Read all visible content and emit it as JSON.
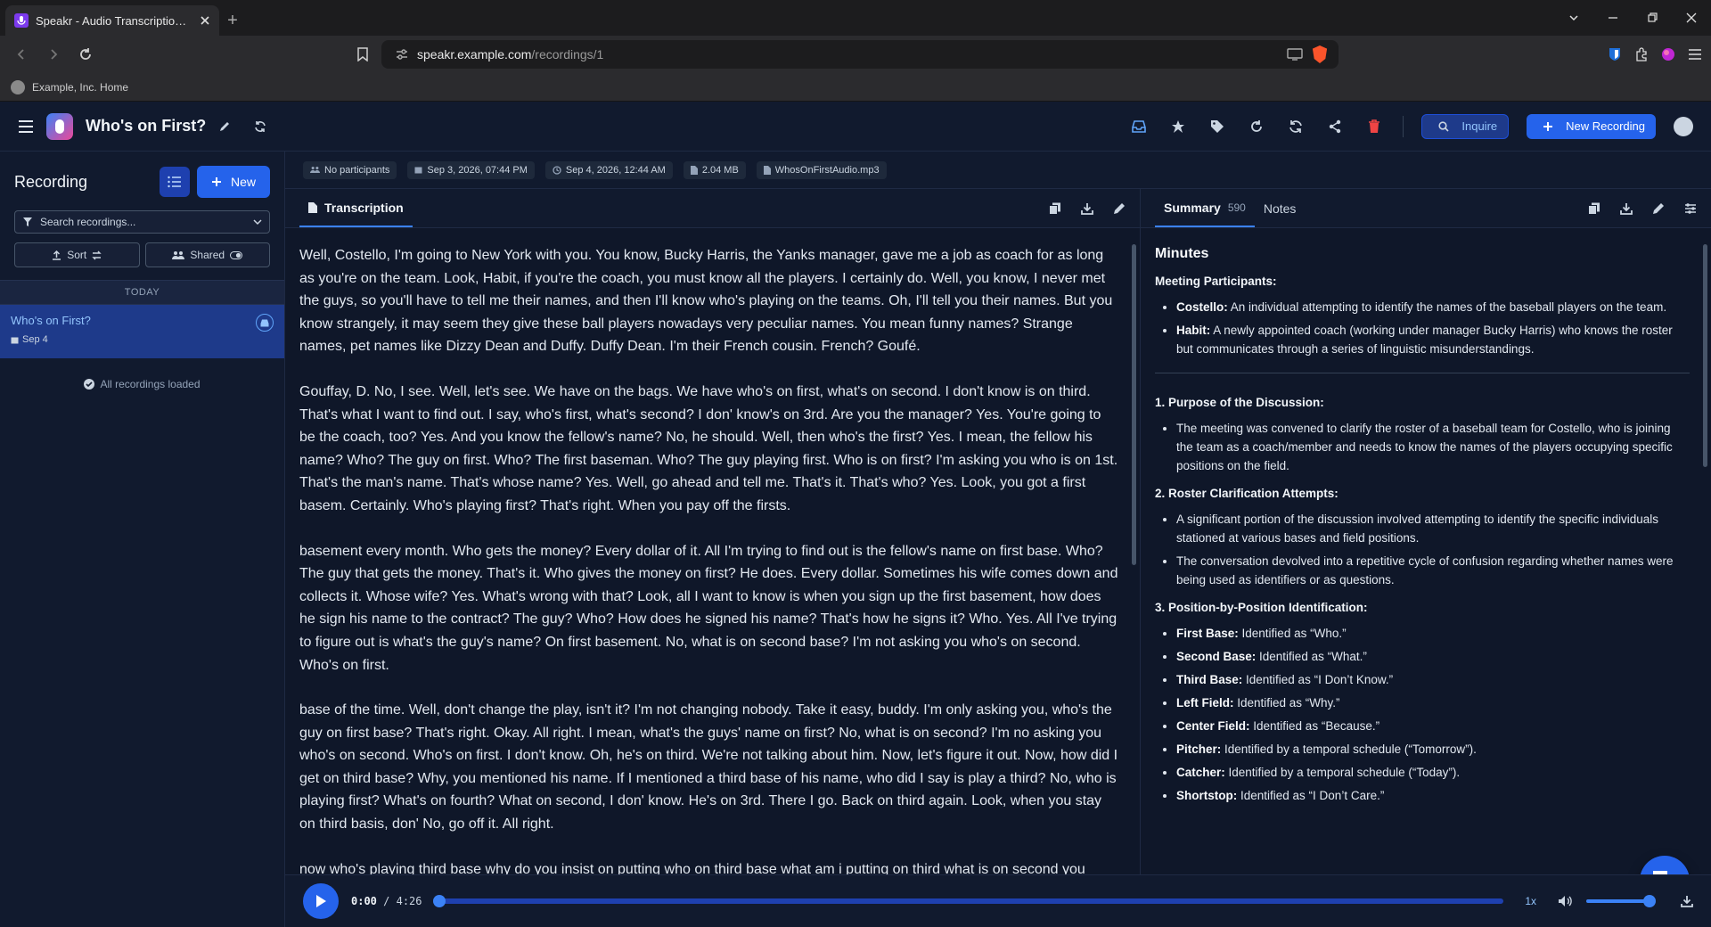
{
  "browser": {
    "tab_title": "Speakr - Audio Transcription & S",
    "url_host": "speakr.example.com",
    "url_path": "/recordings/1",
    "bookmark": "Example, Inc. Home"
  },
  "header": {
    "title": "Who's on First?",
    "inquire_label": "Inquire",
    "new_recording_label": "New Recording"
  },
  "sidebar": {
    "title": "Recording",
    "new_label": "New",
    "search_placeholder": "Search recordings...",
    "sort_label": "Sort",
    "shared_label": "Shared",
    "group_label": "TODAY",
    "items": [
      {
        "title": "Who's on First?",
        "date": "Sep 4"
      }
    ],
    "loaded_label": "All recordings loaded"
  },
  "meta": {
    "participants": "No participants",
    "created": "Sep 3, 2026, 07:44 PM",
    "processed": "Sep 4, 2026, 12:44 AM",
    "size": "2.04 MB",
    "filename": "WhosOnFirstAudio.mp3"
  },
  "left_pane": {
    "tab_label": "Transcription",
    "paragraphs": [
      "Well, Costello, I'm going to New York with you. You know, Bucky Harris, the Yanks manager, gave me a job as coach for as long as you're on the team. Look, Habit, if you're the coach, you must know all the players. I certainly do. Well, you know, I never met the guys, so you'll have to tell me their names, and then I'll know who's playing on the teams. Oh, I'll tell you their names. But you know strangely, it may seem they give these ball players nowadays very peculiar names. You mean funny names? Strange names, pet names like Dizzy Dean and Duffy. Duffy Dean. I'm their French cousin. French? Goufé.",
      "Gouffay, D. No, I see. Well, let's see. We have on the bags. We have who's on first, what's on second. I don't know is on third. That's what I want to find out. I say, who's first, what's second? I don' know's on 3rd. Are you the manager? Yes. You're going to be the coach, too? Yes. And you know the fellow's name? No, he should. Well, then who's the first? Yes. I mean, the fellow his name? Who? The guy on first. Who? The first baseman. Who? The guy playing first. Who is on first? I'm asking you who is on 1st. That's the man's name. That's whose name? Yes. Well, go ahead and tell me. That's it. That's who? Yes. Look, you got a first basem. Certainly. Who's playing first? That's right. When you pay off the firsts.",
      "basement every month. Who gets the money? Every dollar of it. All I'm trying to find out is the fellow's name on first base. Who? The guy that gets the money. That's it. Who gives the money on first? He does. Every dollar. Sometimes his wife comes down and collects it. Whose wife? Yes. What's wrong with that? Look, all I want to know is when you sign up the first basement, how does he sign his name to the contract? The guy? Who? How does he signed his name? That's how he signs it? Who. Yes. All I've trying to figure out is what's the guy's name? On first basement. No, what is on second base? I'm not asking you who's on second. Who's on first.",
      "base of the time. Well, don't change the play, isn't it? I'm not changing nobody. Take it easy, buddy. I'm only asking you, who's the guy on first base? That's right. Okay. All right. I mean, what's the guys' name on first? No, what is on second? I'm no asking you who's on second. Who's on first. I don't know. Oh, he's on third. We're not talking about him. Now, let's figure it out. Now, how did I get on third base? Why, you mentioned his name. If I mentioned a third base of his name, who did I say is play a third? No, who is playing first? What's on fourth? What on second, I don' know. He's on 3rd. There I go. Back on third again. Look, when you stay on third basis, don' No, go off it. All right.",
      "now who's playing third base why do you insist on putting who on third base what am i putting on third what is on second you"
    ]
  },
  "right_pane": {
    "summary_tab": "Summary",
    "summary_count": "590",
    "notes_tab": "Notes",
    "minutes_heading": "Minutes",
    "participants_heading": "Meeting Participants:",
    "participants": [
      {
        "name": "Costello:",
        "desc": " An individual attempting to identify the names of the baseball players on the team."
      },
      {
        "name": "Habit:",
        "desc": " A newly appointed coach (working under manager Bucky Harris) who knows the roster but communicates through a series of linguistic misunderstandings."
      }
    ],
    "purpose_heading": "1. Purpose of the Discussion:",
    "purpose_items": [
      "The meeting was convened to clarify the roster of a baseball team for Costello, who is joining the team as a coach/member and needs to know the names of the players occupying specific positions on the field."
    ],
    "roster_heading": "2. Roster Clarification Attempts:",
    "roster_items": [
      "A significant portion of the discussion involved attempting to identify the specific individuals stationed at various bases and field positions.",
      "The conversation devolved into a repetitive cycle of confusion regarding whether names were being used as identifiers or as questions."
    ],
    "positions_heading": "3. Position-by-Position Identification:",
    "positions": [
      {
        "name": "First Base:",
        "desc": " Identified as “Who.”"
      },
      {
        "name": "Second Base:",
        "desc": " Identified as “What.”"
      },
      {
        "name": "Third Base:",
        "desc": " Identified as “I Don’t Know.”"
      },
      {
        "name": "Left Field:",
        "desc": " Identified as “Why.”"
      },
      {
        "name": "Center Field:",
        "desc": " Identified as “Because.”"
      },
      {
        "name": "Pitcher:",
        "desc": " Identified by a temporal schedule (“Tomorrow”)."
      },
      {
        "name": "Catcher:",
        "desc": " Identified by a temporal schedule (“Today”)."
      },
      {
        "name": "Shortstop:",
        "desc": " Identified as “I Don’t Care.”"
      }
    ]
  },
  "player": {
    "current_time": "0:00",
    "separator": "/",
    "duration": "4:26",
    "playback_rate": "1x",
    "progress_fraction": 0,
    "volume_fraction": 1
  },
  "colors": {
    "accent": "#2563eb",
    "delete": "#ef4444",
    "background": "#0f1729"
  }
}
